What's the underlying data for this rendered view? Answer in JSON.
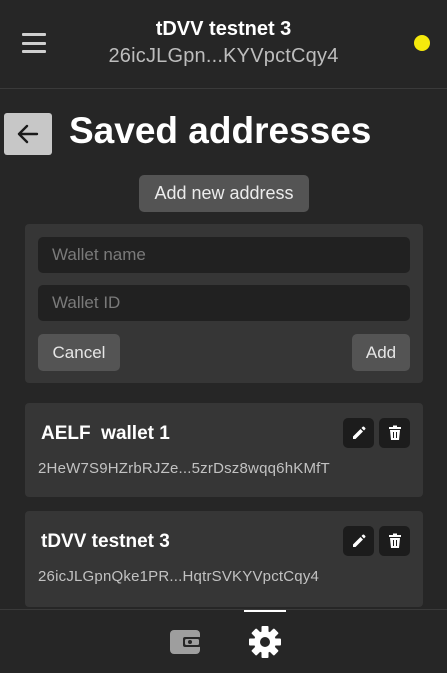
{
  "header": {
    "network_name": "tDVV testnet 3",
    "address_short": "26icJLGpn...KYVpctCqy4",
    "status_color": "#f5e90c",
    "menu_icon": "hamburger-menu-icon"
  },
  "page": {
    "title": "Saved addresses",
    "back_icon": "arrow-left-icon",
    "add_new_label": "Add new address"
  },
  "form": {
    "name_placeholder": "Wallet name",
    "name_value": "",
    "id_placeholder": "Wallet ID",
    "id_value": "",
    "cancel_label": "Cancel",
    "add_label": "Add"
  },
  "wallets": [
    {
      "name": "AELF  wallet 1",
      "address": "2HeW7S9HZrbRJZe...5zrDsz8wqq6hKMfT"
    },
    {
      "name": "tDVV testnet 3",
      "address": "26icJLGpnQke1PR...HqtrSVKYVpctCqy4"
    }
  ],
  "bottom_nav": {
    "items": [
      {
        "icon": "wallet-icon",
        "active": false
      },
      {
        "icon": "gear-icon",
        "active": true
      }
    ]
  }
}
